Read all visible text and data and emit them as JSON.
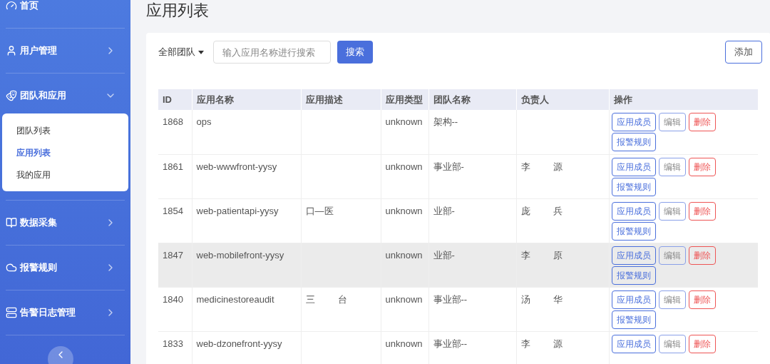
{
  "sidebar": {
    "items": [
      {
        "label": "首页",
        "kind": "link"
      },
      {
        "label": "用户管理",
        "kind": "group",
        "expanded": false
      },
      {
        "label": "团队和应用",
        "kind": "group",
        "expanded": true,
        "children": [
          {
            "label": "团队列表",
            "selected": false
          },
          {
            "label": "应用列表",
            "selected": true
          },
          {
            "label": "我的应用",
            "selected": false
          }
        ]
      },
      {
        "label": "数据采集",
        "kind": "group",
        "expanded": false
      },
      {
        "label": "报警规则",
        "kind": "group",
        "expanded": false
      },
      {
        "label": "告警日志管理",
        "kind": "group",
        "expanded": false
      }
    ]
  },
  "page_title": "应用列表",
  "toolbar": {
    "team_filter": "全部团队",
    "search": {
      "placeholder": "输入应用名称进行搜索"
    },
    "search_button": "搜索",
    "add_button": "添加"
  },
  "table": {
    "columns": [
      "ID",
      "应用名称",
      "应用描述",
      "应用类型",
      "团队名称",
      "负责人",
      "操作"
    ],
    "rows": [
      {
        "id": "1868",
        "name": "ops",
        "description": [],
        "type": "unknown",
        "team": [
          "架构--"
        ],
        "owner": [],
        "highlighted": false,
        "actions": [
          "应用成员",
          "编辑",
          "删除",
          "报警规则"
        ]
      },
      {
        "id": "1861",
        "name": "web-wwwfront-yysy",
        "description": [],
        "type": "unknown",
        "team": [
          "事业部-"
        ],
        "owner": [
          "李",
          "源"
        ],
        "highlighted": false,
        "actions": [
          "应用成员",
          "编辑",
          "删除",
          "报警规则"
        ]
      },
      {
        "id": "1854",
        "name": "web-patientapi-yysy",
        "description": [
          "口—医"
        ],
        "type": "unknown",
        "team": [
          "业部-"
        ],
        "owner": [
          "庞",
          "兵"
        ],
        "highlighted": false,
        "actions": [
          "应用成员",
          "编辑",
          "删除",
          "报警规则"
        ]
      },
      {
        "id": "1847",
        "name": "web-mobilefront-yysy",
        "description": [],
        "type": "unknown",
        "team": [
          "业部-"
        ],
        "owner": [
          "李",
          "原"
        ],
        "highlighted": true,
        "actions": [
          "应用成员",
          "编辑",
          "删除",
          "报警规则"
        ]
      },
      {
        "id": "1840",
        "name": "medicinestoreaudit",
        "description": [
          "三",
          "台"
        ],
        "type": "unknown",
        "team": [
          "事业部--"
        ],
        "owner": [
          "汤",
          "华"
        ],
        "highlighted": false,
        "actions": [
          "应用成员",
          "编辑",
          "删除",
          "报警规则"
        ]
      },
      {
        "id": "1833",
        "name": "web-dzonefront-yysy",
        "description": [],
        "type": "unknown",
        "team": [
          "事业部--"
        ],
        "owner": [
          "李",
          "源"
        ],
        "highlighted": false,
        "actions": [
          "应用成员",
          "编辑",
          "删除"
        ]
      }
    ]
  }
}
